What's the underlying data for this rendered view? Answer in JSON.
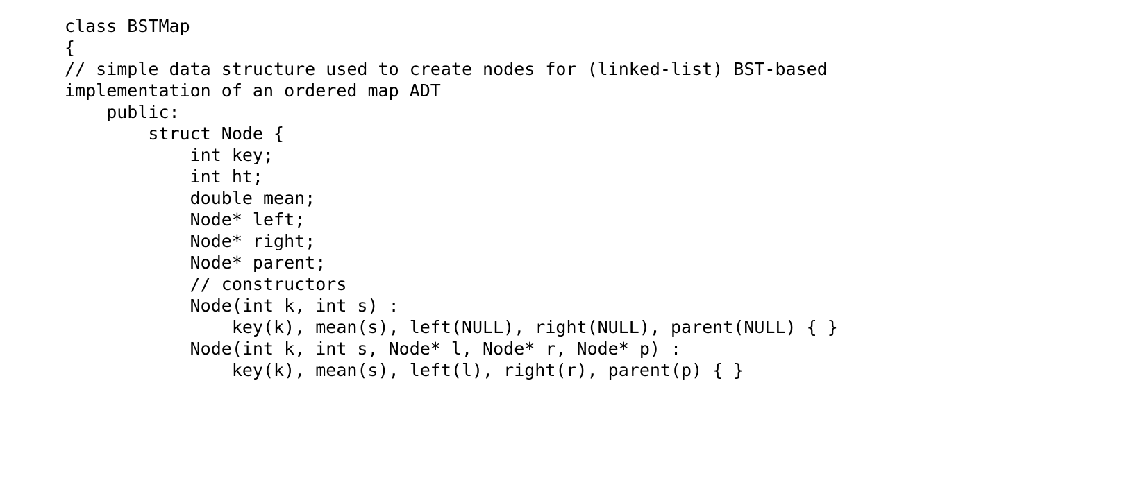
{
  "document": {
    "kind": "code-listing",
    "language": "C++",
    "background_color": "#ffffff",
    "text_color": "#000000",
    "lines": [
      {
        "text": "class BSTMap"
      },
      {
        "text": "{"
      },
      {
        "text": "// simple data structure used to create nodes for (linked-list) BST-based"
      },
      {
        "text": "implementation of an ordered map ADT"
      },
      {
        "text": "    public:"
      },
      {
        "text": "        struct Node {"
      },
      {
        "text": "            int key;"
      },
      {
        "text": "            int ht;"
      },
      {
        "text": "            double mean;"
      },
      {
        "text": "            Node* left;"
      },
      {
        "text": "            Node* right;"
      },
      {
        "text": "            Node* parent;"
      },
      {
        "text": "            // constructors"
      },
      {
        "text": "            Node(int k, int s) :"
      },
      {
        "text": "                key(k), mean(s), left(NULL), right(NULL), parent(NULL) { }"
      },
      {
        "text": "            Node(int k, int s, Node* l, Node* r, Node* p) :"
      },
      {
        "text": "                key(k), mean(s), left(l), right(r), parent(p) { }"
      }
    ]
  }
}
